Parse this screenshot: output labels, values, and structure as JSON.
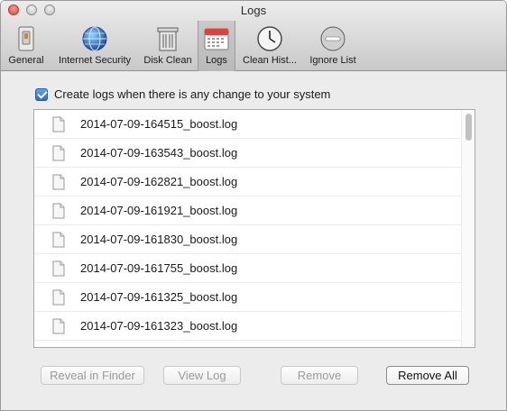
{
  "window": {
    "title": "Logs"
  },
  "toolbar": {
    "items": [
      {
        "label": "General",
        "icon": "switch-icon",
        "selected": false
      },
      {
        "label": "Internet Security",
        "icon": "globe-icon",
        "selected": false
      },
      {
        "label": "Disk Clean",
        "icon": "trash-icon",
        "selected": false
      },
      {
        "label": "Logs",
        "icon": "calendar-icon",
        "selected": true
      },
      {
        "label": "Clean Hist...",
        "icon": "clock-icon",
        "selected": false
      },
      {
        "label": "Ignore List",
        "icon": "minus-circle-icon",
        "selected": false
      }
    ]
  },
  "options": {
    "create_logs_label": "Create logs when there is any change to your system",
    "create_logs_checked": true
  },
  "logs": {
    "files": [
      "2014-07-09-164515_boost.log",
      "2014-07-09-163543_boost.log",
      "2014-07-09-162821_boost.log",
      "2014-07-09-161921_boost.log",
      "2014-07-09-161830_boost.log",
      "2014-07-09-161755_boost.log",
      "2014-07-09-161325_boost.log",
      "2014-07-09-161323_boost.log"
    ]
  },
  "buttons": {
    "reveal_label": "Reveal in Finder",
    "view_label": "View Log",
    "remove_label": "Remove",
    "remove_all_label": "Remove All"
  },
  "colors": {
    "accent": "#2a7be4",
    "selected_tool_bg": "#c0c0c0"
  }
}
